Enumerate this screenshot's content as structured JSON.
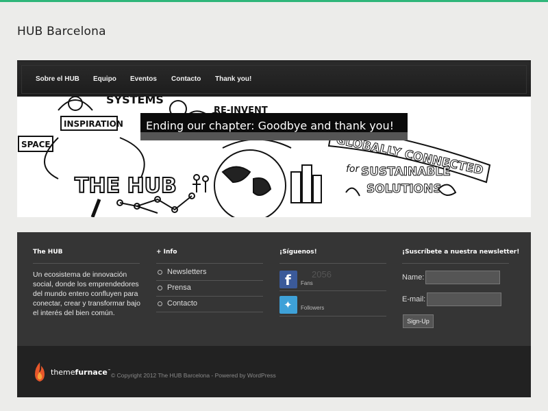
{
  "site": {
    "title": "HUB Barcelona",
    "accent_color": "#2fb67a"
  },
  "nav": {
    "items": [
      {
        "label": "Sobre el HUB"
      },
      {
        "label": "Equipo"
      },
      {
        "label": "Eventos"
      },
      {
        "label": "Contacto"
      },
      {
        "label": "Thank you!"
      }
    ]
  },
  "hero": {
    "caption": "Ending our chapter: Goodbye and thank you!",
    "sketch_words": {
      "systems": "SYSTEMS",
      "reinvent": "RE-INVENT",
      "inspiration": "INSPIRATION",
      "space": "SPACE",
      "the_hub": "THE HUB",
      "globally_connected": "GLOBALLY CONNECTED",
      "for": "for",
      "sustainable": "SUSTAINABLE",
      "solutions": "SOLUTIONS"
    }
  },
  "footer": {
    "about": {
      "title": "The HUB",
      "text": "Un ecosistema de innovación social, donde los emprendedores del mundo entero confluyen para conectar, crear y transformar bajo el interés del bien común."
    },
    "info": {
      "title": "+ Info",
      "links": [
        {
          "label": "Newsletters"
        },
        {
          "label": "Prensa"
        },
        {
          "label": "Contacto"
        }
      ]
    },
    "social": {
      "title": "¡Síguenos!",
      "facebook": {
        "icon": "facebook-icon",
        "count": "2056",
        "label": "Fans"
      },
      "twitter": {
        "icon": "twitter-icon",
        "label": "Followers"
      }
    },
    "newsletter": {
      "title": "¡Suscríbete a nuestra newsletter!",
      "name_label": "Name:",
      "email_label": "E-mail:",
      "button_label": "Sign-Up"
    }
  },
  "bottom": {
    "brand_light": "theme",
    "brand_bold": "furnace",
    "brand_tm": "™",
    "copyright": "© Copyright 2012 The HUB Barcelona - Powered by WordPress"
  }
}
